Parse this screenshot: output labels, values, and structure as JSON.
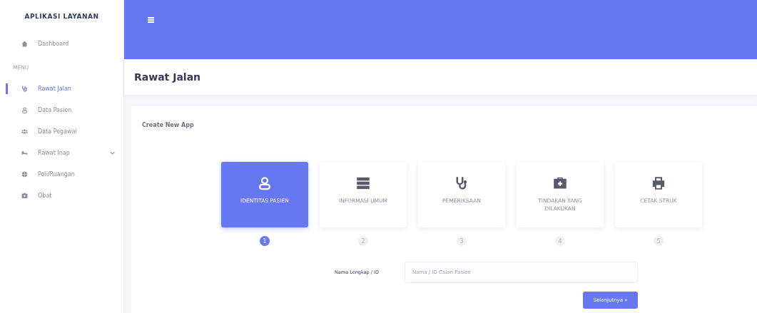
{
  "sidebar": {
    "brand": "APLIKASI LAYANAN",
    "items": [
      {
        "label": "Dashboard",
        "selected": false,
        "expandable": false
      },
      {
        "kind": "heading",
        "label": "MENU"
      },
      {
        "label": "Rawat Jalan",
        "selected": true,
        "expandable": false
      },
      {
        "label": "Data Pasien",
        "selected": false,
        "expandable": false
      },
      {
        "label": "Data Pegawai",
        "selected": false,
        "expandable": false
      },
      {
        "label": "Rawat Inap",
        "selected": false,
        "expandable": true
      },
      {
        "label": "Poli/Ruangan",
        "selected": false,
        "expandable": false
      },
      {
        "label": "Obat",
        "selected": false,
        "expandable": false
      }
    ]
  },
  "page": {
    "title": "Rawat Jalan"
  },
  "card": {
    "title": "Create New App",
    "steps": [
      {
        "label": "IDENTITAS PASIEN",
        "selected": true,
        "number": "1"
      },
      {
        "label": "INFORMASI UMUM",
        "selected": false,
        "number": "2"
      },
      {
        "label": "PEMERIKSAAN",
        "selected": false,
        "number": "3"
      },
      {
        "label": "TINDAKAN YANG DILAKUKAN",
        "selected": false,
        "number": "4"
      },
      {
        "label": "CETAK STRUK",
        "selected": false,
        "number": "5"
      }
    ],
    "field": {
      "label": "Nama Lengkap / ID",
      "placeholder": "Nama / ID Calon Pasien"
    },
    "button": "Selanjutnya »"
  }
}
